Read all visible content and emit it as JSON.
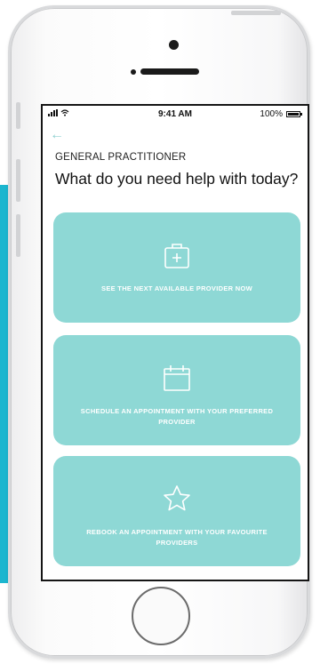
{
  "status_bar": {
    "time": "9:41 AM",
    "battery": "100%",
    "battery_level": 1.0
  },
  "header": {
    "back_icon": "←",
    "category": "GENERAL PRACTITIONER",
    "question": "What do you need help with today?"
  },
  "options": [
    {
      "label": "SEE THE NEXT AVAILABLE PROVIDER NOW",
      "icon": "medical-bag-icon"
    },
    {
      "label": "SCHEDULE AN APPOINTMENT WITH YOUR PREFERRED PROVIDER",
      "icon": "calendar-icon"
    },
    {
      "label": "REBOOK AN APPOINTMENT WITH YOUR FAVOURITE PROVIDERS",
      "icon": "star-icon"
    }
  ],
  "colors": {
    "accent": "#1bb6cf",
    "card": "#8ed8d5",
    "card_text": "#ffffff"
  }
}
